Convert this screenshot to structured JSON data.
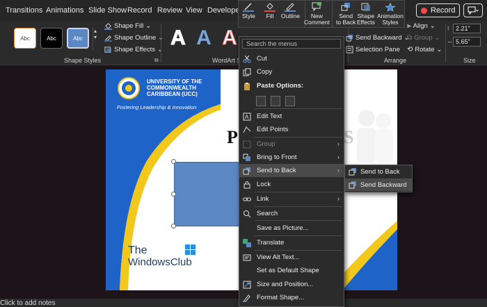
{
  "tabs": [
    "Transitions",
    "Animations",
    "Slide Show",
    "Record",
    "Review",
    "View",
    "Developer"
  ],
  "record_button": "Record",
  "ribbon": {
    "shape_styles": {
      "swatches": [
        "Abc",
        "Abc",
        "Abc"
      ],
      "fill": "Shape Fill",
      "outline": "Shape Outline",
      "effects": "Shape Effects",
      "label": "Shape Styles"
    },
    "wordart": {
      "letters": [
        "A",
        "A",
        "A"
      ],
      "label": "WordArt S"
    },
    "arrange": {
      "send_backward": "Send Backward",
      "selection_pane": "Selection Pane",
      "align": "Align",
      "group": "Group",
      "rotate": "Rotate",
      "label": "Arrange"
    },
    "size": {
      "height": "2.21\"",
      "width": "5.65\"",
      "label": "Size"
    }
  },
  "mini_toolbar": {
    "style": "Style",
    "fill": "Fill",
    "outline": "Outline",
    "new_comment": [
      "New",
      "Comment"
    ],
    "send_to_back": [
      "Send",
      "to Back"
    ],
    "shape_effects": [
      "Shape",
      "Effects"
    ],
    "animation_styles": [
      "Animation",
      "Styles"
    ]
  },
  "slide": {
    "university": [
      "UNIVERSITY OF THE",
      "COMMONWEALTH",
      "CARIBBEAN (UCC)"
    ],
    "tagline": "Fostering Leadership & Innovation",
    "title_left": "P",
    "title_right": "S",
    "watermark": [
      "The",
      "WindowsClub"
    ]
  },
  "notes": "Click to add notes",
  "context_menu": {
    "search_placeholder": "Search the menus",
    "items": {
      "cut": "Cut",
      "copy": "Copy",
      "paste_options": "Paste Options:",
      "edit_text": "Edit Text",
      "edit_points": "Edit Points",
      "group": "Group",
      "bring_to_front": "Bring to Front",
      "send_to_back": "Send to Back",
      "lock": "Lock",
      "link": "Link",
      "search": "Search",
      "save_as_picture": "Save as Picture...",
      "translate": "Translate",
      "view_alt_text": "View Alt Text...",
      "set_default": "Set as Default Shape",
      "size_position": "Size and Position...",
      "format_shape": "Format Shape..."
    }
  },
  "submenu": {
    "send_to_back": "Send to Back",
    "send_backward": "Send Backward"
  },
  "colors": {
    "accent_blue": "#5b87c5",
    "record_red": "#ff4848",
    "slide_blue": "#1e63c8",
    "slide_yellow": "#f2c81c"
  }
}
